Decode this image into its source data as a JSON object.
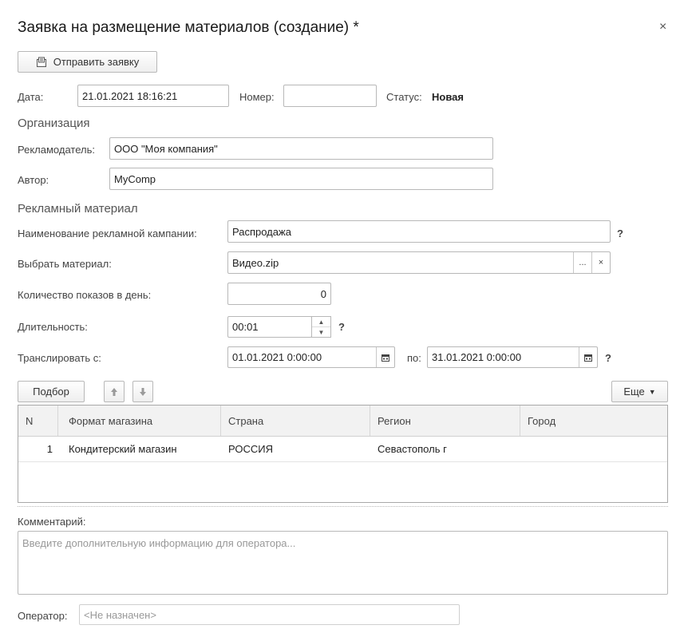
{
  "window": {
    "title": "Заявка на размещение материалов (создание) *",
    "close_label": "×"
  },
  "toolbar": {
    "send_button": "Отправить заявку"
  },
  "header": {
    "date_label": "Дата:",
    "date_value": "21.01.2021 18:16:21",
    "number_label": "Номер:",
    "number_value": "",
    "status_label": "Статус:",
    "status_value": "Новая"
  },
  "organization": {
    "section_title": "Организация",
    "advertiser_label": "Рекламодатель:",
    "advertiser_value": "ООО \"Моя компания\"",
    "author_label": "Автор:",
    "author_value": "MyComp"
  },
  "material": {
    "section_title": "Рекламный материал",
    "campaign_label": "Наименование рекламной кампании:",
    "campaign_value": "Распродажа",
    "select_label": "Выбрать материал:",
    "select_value": "Видео.zip",
    "select_button": "...",
    "clear_button": "×",
    "shows_label": "Количество показов в день:",
    "shows_value": "0",
    "duration_label": "Длительность:",
    "duration_value": "00:01",
    "broadcast_label": "Транслировать с:",
    "from_value": "01.01.2021  0:00:00",
    "to_label": "по:",
    "to_value": "31.01.2021  0:00:00",
    "help_mark": "?"
  },
  "table_toolbar": {
    "pick_button": "Подбор",
    "more_button": "Еще"
  },
  "table": {
    "columns": [
      "N",
      "Формат магазина",
      "Страна",
      "Регион",
      "Город"
    ],
    "rows": [
      {
        "n": "1",
        "format": "Кондитерский магазин",
        "country": "РОССИЯ",
        "region": "Севастополь г",
        "city": ""
      }
    ]
  },
  "comment": {
    "label": "Комментарий:",
    "placeholder": "Введите дополнительную информацию для оператора..."
  },
  "operator": {
    "label": "Оператор:",
    "value": "<Не назначен>"
  }
}
